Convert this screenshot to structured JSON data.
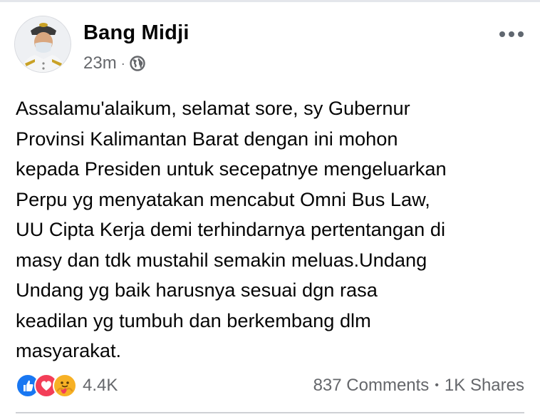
{
  "post": {
    "author": "Bang Midji",
    "timestamp": "23m",
    "meta_separator": "·",
    "privacy_icon": "globe-icon",
    "more_icon": "more-horizontal-icon",
    "text": "Assalamu'alaikum, selamat sore, sy Gubernur\nProvinsi Kalimantan Barat dengan ini mohon\nkepada Presiden untuk secepatnye mengeluarkan\nPerpu yg menyatakan mencabut Omni Bus Law,\nUU Cipta Kerja demi terhindarnya pertentangan di\nmasy dan tdk mustahil semakin meluas.Undang\nUndang yg baik harusnya sesuai dgn rasa\nkeadilan yg tumbuh dan berkembang dlm\nmasyarakat."
  },
  "footer": {
    "reactions": [
      "like-icon",
      "love-icon",
      "care-icon"
    ],
    "reaction_count": "4.4K",
    "comments": "837 Comments",
    "separator": "•",
    "shares": "1K Shares"
  },
  "colors": {
    "like": "#1877f2",
    "love": "#f33e58",
    "care": "#f7b125",
    "secondary_text": "#65676b"
  }
}
